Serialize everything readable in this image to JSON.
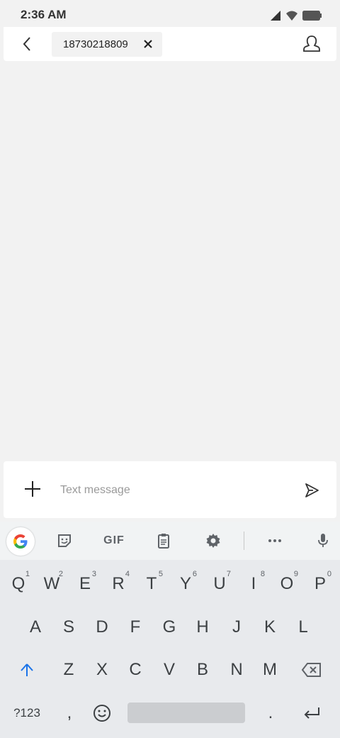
{
  "status_bar": {
    "time": "2:36 AM",
    "icons": [
      "cell-signal-icon",
      "wifi-icon",
      "battery-icon"
    ]
  },
  "header": {
    "recipient": "18730218809",
    "back_icon": "back-arrow-icon",
    "remove_icon": "close-icon",
    "contact_icon": "contact-icon"
  },
  "compose": {
    "placeholder": "Text message",
    "add_icon": "plus-icon",
    "send_icon": "send-icon"
  },
  "keyboard": {
    "toolbar": [
      "google-icon",
      "sticker-icon",
      "gif-label",
      "clipboard-icon",
      "settings-icon",
      "more-icon",
      "mic-icon"
    ],
    "gif_label": "GIF",
    "row1": [
      "Q",
      "W",
      "E",
      "R",
      "T",
      "Y",
      "U",
      "I",
      "O",
      "P"
    ],
    "row1_hints": [
      "1",
      "2",
      "3",
      "4",
      "5",
      "6",
      "7",
      "8",
      "9",
      "0"
    ],
    "row2": [
      "A",
      "S",
      "D",
      "F",
      "G",
      "H",
      "J",
      "K",
      "L"
    ],
    "row3": [
      "Z",
      "X",
      "C",
      "V",
      "B",
      "N",
      "M"
    ],
    "symbols_label": "?123",
    "comma": ",",
    "period": "."
  }
}
